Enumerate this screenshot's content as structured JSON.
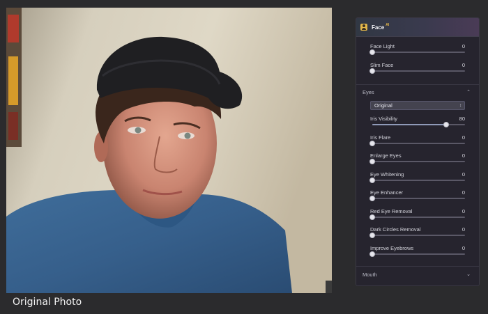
{
  "caption": "Original Photo",
  "panel": {
    "title": "Face",
    "badge": "AI",
    "top_sliders": [
      {
        "label": "Face Light",
        "value": "0",
        "level": 0
      },
      {
        "label": "Slim Face",
        "value": "0",
        "level": 0
      }
    ],
    "eyes": {
      "title": "Eyes",
      "dropdown_value": "Original",
      "sliders": [
        {
          "label": "Iris Visibility",
          "value": "80",
          "level": 0.8
        },
        {
          "label": "Iris Flare",
          "value": "0",
          "level": 0
        },
        {
          "label": "Enlarge Eyes",
          "value": "0",
          "level": 0
        },
        {
          "label": "Eye Whitening",
          "value": "0",
          "level": 0
        },
        {
          "label": "Eye Enhancer",
          "value": "0",
          "level": 0
        },
        {
          "label": "Red Eye Removal",
          "value": "0",
          "level": 0
        },
        {
          "label": "Dark Circles Removal",
          "value": "0",
          "level": 0
        },
        {
          "label": "Improve Eyebrows",
          "value": "0",
          "level": 0
        }
      ]
    },
    "mouth": {
      "title": "Mouth"
    }
  },
  "colors": {
    "panel_bg": "#26242e",
    "accent_icon": "#e3b74a",
    "slider_fill": "#8f9ab8"
  },
  "icons": [
    "face-ai-icon",
    "chevron-up-icon",
    "chevron-down-icon",
    "updown-arrow-icon"
  ]
}
